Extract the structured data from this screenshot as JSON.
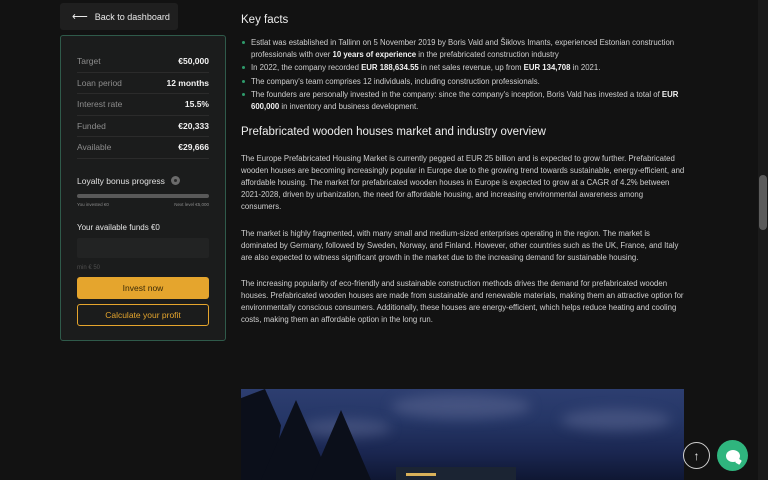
{
  "back_button": {
    "label": "Back to dashboard",
    "icon": "arrow-left-icon"
  },
  "investment_panel": {
    "stats": [
      {
        "label": "Target",
        "value": "€50,000"
      },
      {
        "label": "Loan period",
        "value": "12 months"
      },
      {
        "label": "Interest rate",
        "value": "15.5%"
      },
      {
        "label": "Funded",
        "value": "€20,333"
      },
      {
        "label": "Available",
        "value": "€29,666"
      }
    ],
    "loyalty": {
      "label": "Loyalty bonus progress",
      "icon": "gear-icon",
      "progress": 0,
      "left_label": "You invested €0",
      "right_label": "Next level €5,000"
    },
    "funds_label": "Your available funds €0",
    "amount_input": {
      "value": "",
      "placeholder": ""
    },
    "min_label": "min € 50",
    "invest_button": "Invest now",
    "profit_button": "Calculate your profit",
    "colors": {
      "accent": "#e5a52d",
      "border": "#2f5a4a"
    }
  },
  "key_facts": {
    "title": "Key facts",
    "items": [
      {
        "p1": "Estlat was established in Tallinn on 5 November 2019 by Boris Vald and Šiklovs Imants, experienced Estonian construction professionals with over ",
        "b1": "10 years of experience",
        "p2": " in the prefabricated construction industry",
        "b2": "",
        "p3": ""
      },
      {
        "p1": "In 2022, the company recorded ",
        "b1": "EUR 188,634.55",
        "p2": " in net sales revenue, up from ",
        "b2": "EUR 134,708",
        "p3": " in 2021."
      },
      {
        "p1": "The company's team comprises 12 individuals, including construction professionals.",
        "b1": "",
        "p2": "",
        "b2": "",
        "p3": ""
      },
      {
        "p1": "The founders are personally invested in the company: since the company's inception, Boris Vald has invested a total of ",
        "b1": "EUR 600,000",
        "p2": " in inventory and business development.",
        "b2": "",
        "p3": ""
      }
    ]
  },
  "market": {
    "title": "Prefabricated wooden houses market and industry overview",
    "paragraphs": [
      "The Europe Prefabricated Housing Market is currently pegged at EUR 25 billion and is expected to grow further. Prefabricated wooden houses are becoming increasingly popular in Europe due to the growing trend towards sustainable, energy-efficient, and affordable housing. The market for prefabricated wooden houses in Europe is expected to grow at a CAGR of 4.2% between 2021-2028, driven by urbanization, the need for affordable housing, and increasing environmental awareness among consumers.",
      "The market is highly fragmented, with many small and medium-sized enterprises operating in the region. The market is dominated by Germany, followed by Sweden, Norway, and Finland. However, other countries such as the UK, France, and Italy are also expected to witness significant growth in the market due to the increasing demand for sustainable housing.",
      "The increasing popularity of eco-friendly and sustainable construction methods drives the demand for prefabricated wooden houses. Prefabricated wooden houses are made from sustainable and renewable materials, making them an attractive option for environmentally conscious consumers. Additionally, these houses are energy-efficient, which helps reduce heating and cooling costs, making them an affordable option in the long run."
    ]
  },
  "floating": {
    "scroll_top_icon": "arrow-up-icon",
    "chat_icon": "chat-bubble-icon",
    "chat_color": "#2fb57e"
  }
}
